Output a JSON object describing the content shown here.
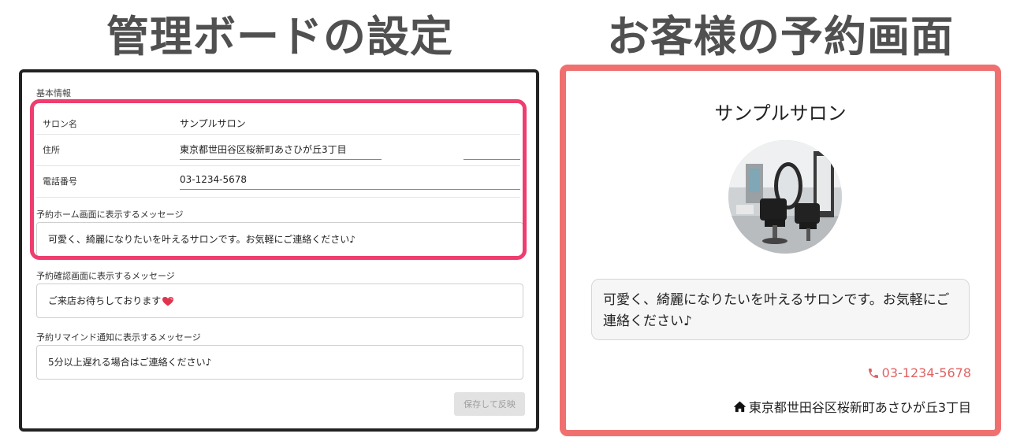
{
  "headings": {
    "admin": "管理ボードの設定",
    "customer": "お客様の予約画面"
  },
  "admin": {
    "section_title": "基本情報",
    "fields": {
      "salon_name": {
        "label": "サロン名",
        "value": "サンプルサロン"
      },
      "address": {
        "label": "住所",
        "value": "東京都世田谷区桜新町あさひが丘3丁目"
      },
      "phone": {
        "label": "電話番号",
        "value": "03-1234-5678"
      }
    },
    "messages": {
      "home": {
        "label": "予約ホーム画面に表示するメッセージ",
        "value": "可愛く、綺麗になりたいを叶えるサロンです。お気軽にご連絡ください♪"
      },
      "confirm": {
        "label": "予約確認画面に表示するメッセージ",
        "value": "ご来店お待ちしております"
      },
      "remind": {
        "label": "予約リマインド通知に表示するメッセージ",
        "value": "5分以上遅れる場合はご連絡ください♪"
      }
    },
    "save_label": "保存して反映",
    "colors": {
      "highlight": "#ee3d6e",
      "frame": "#222222"
    }
  },
  "booking": {
    "salon_name": "サンプルサロン",
    "intro": "可愛く、綺麗になりたいを叶えるサロンです。お気軽にご連絡ください♪",
    "phone": "03-1234-5678",
    "address": "東京都世田谷区桜新町あさひが丘3丁目",
    "phone_icon": "phone-icon",
    "address_icon": "home-icon",
    "colors": {
      "frame": "#f07070",
      "phone": "#e06262"
    }
  }
}
